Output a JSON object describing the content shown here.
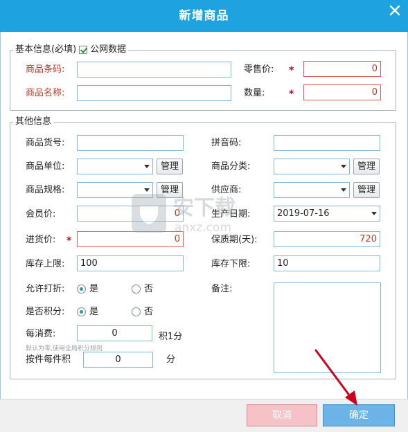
{
  "dialog": {
    "title": "新增商品",
    "close_icon": "close-icon"
  },
  "basic": {
    "legend": "基本信息(必填)",
    "public_data_label": "公网数据",
    "public_data_checked": true,
    "barcode_label": "商品条码:",
    "barcode_value": "",
    "name_label": "商品名称:",
    "name_value": "",
    "retail_price_label": "零售价:",
    "retail_price_value": "0",
    "quantity_label": "数量:",
    "quantity_value": "0",
    "required_mark": "*"
  },
  "other": {
    "legend": "其他信息",
    "item_no_label": "商品货号:",
    "item_no_value": "",
    "pinyin_label": "拼音码:",
    "pinyin_value": "",
    "unit_label": "商品单位:",
    "unit_value": "",
    "category_label": "商品分类:",
    "category_value": "",
    "spec_label": "商品规格:",
    "spec_value": "",
    "supplier_label": "供应商:",
    "supplier_value": "",
    "manage_label": "管理",
    "member_price_label": "会员价:",
    "member_price_value": "0",
    "production_date_label": "生产日期:",
    "production_date_value": "2019-07-16",
    "purchase_price_label": "进货价:",
    "purchase_price_value": "0",
    "shelf_life_label": "保质期(天):",
    "shelf_life_value": "720",
    "stock_upper_label": "库存上限:",
    "stock_upper_value": "100",
    "stock_lower_label": "库存下限:",
    "stock_lower_value": "10",
    "allow_discount_label": "允许打折:",
    "points_label": "是否积分:",
    "yes_label": "是",
    "no_label": "否",
    "allow_discount_yes": true,
    "points_yes": true,
    "remark_label": "备注:",
    "per_spend_label": "每消费:",
    "per_spend_value": "0",
    "per_spend_suffix": "积1分",
    "per_spend_hint": "默认为零,使用全局积分规则",
    "per_piece_label": "按件每件积",
    "per_piece_value": "0",
    "per_piece_suffix": "分"
  },
  "footer": {
    "cancel_label": "取消",
    "ok_label": "确定"
  },
  "watermark": {
    "text": "安下载",
    "sub": "anxz.com"
  },
  "colors": {
    "titlebar": "#1ea2e0",
    "required": "#c0392b",
    "ok_button": "#6cb4e8",
    "cancel_button": "#f5c2c7",
    "arrow": "#d0021b"
  }
}
